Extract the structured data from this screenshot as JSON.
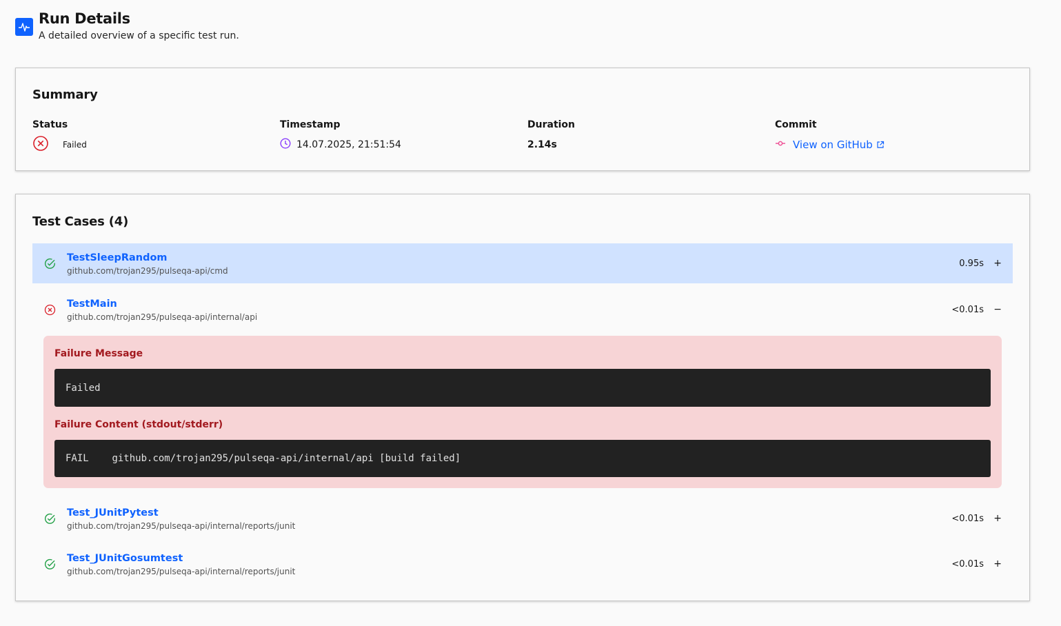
{
  "header": {
    "title": "Run Details",
    "subtitle": "A detailed overview of a specific test run.",
    "icon": "activity-icon"
  },
  "summary": {
    "title": "Summary",
    "status": {
      "label": "Status",
      "value": "Failed",
      "icon": "error-circle-icon",
      "color": "#da1e28"
    },
    "timestamp": {
      "label": "Timestamp",
      "value": "14.07.2025, 21:51:54",
      "icon": "clock-icon",
      "color": "#8a3ffc"
    },
    "duration": {
      "label": "Duration",
      "value": "2.14s"
    },
    "commit": {
      "label": "Commit",
      "link_text": "View on GitHub",
      "icon": "commit-icon",
      "color": "#ee5396"
    }
  },
  "tests": {
    "title": "Test Cases (4)",
    "items": [
      {
        "name": "TestSleepRandom",
        "package": "github.com/trojan295/pulseqa-api/cmd",
        "duration": "0.95s",
        "toggle": "+",
        "status": "passed"
      },
      {
        "name": "TestMain",
        "package": "github.com/trojan295/pulseqa-api/internal/api",
        "duration": "<0.01s",
        "toggle": "−",
        "status": "failed"
      },
      {
        "name": "Test_JUnitPytest",
        "package": "github.com/trojan295/pulseqa-api/internal/reports/junit",
        "duration": "<0.01s",
        "toggle": "+",
        "status": "passed"
      },
      {
        "name": "Test_JUnitGosumtest",
        "package": "github.com/trojan295/pulseqa-api/internal/reports/junit",
        "duration": "<0.01s",
        "toggle": "+",
        "status": "passed"
      }
    ],
    "failure": {
      "message_label": "Failure Message",
      "message": "Failed",
      "content_label": "Failure Content (stdout/stderr)",
      "content": "FAIL\tgithub.com/trojan295/pulseqa-api/internal/api [build failed]"
    }
  },
  "colors": {
    "accent": "#0f62fe",
    "passed": "#24a148",
    "failed": "#da1e28",
    "selected_row": "#d0e2ff",
    "failure_bg": "#f7d4d6"
  }
}
